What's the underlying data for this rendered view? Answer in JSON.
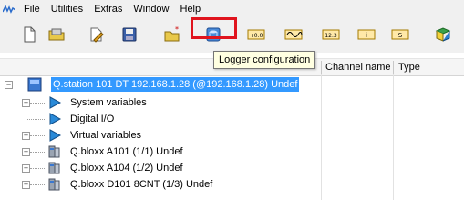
{
  "menubar": {
    "items": [
      "File",
      "Utilities",
      "Extras",
      "Window",
      "Help"
    ]
  },
  "toolbar": {
    "buttons": [
      "new-file-icon",
      "open-folder-icon",
      "edit-file-icon",
      "save-disk-icon",
      "open-special-icon",
      "logger-configuration-icon",
      "numeric-display-icon",
      "signal-icon",
      "numeric-value-icon",
      "indicator-icon",
      "scale-icon",
      "book-icon"
    ],
    "numeric_display_text": "+0.0",
    "numeric_value_text": "12.3",
    "indicator_text": "i",
    "scale_text": "S",
    "highlight_color": "#e0141e"
  },
  "tooltip": {
    "text": "Logger configuration"
  },
  "columns": {
    "channel_name": "Channel name",
    "type": "Type"
  },
  "tree": {
    "root": {
      "label": "Q.station 101 DT 192.168.1.28 (@192.168.1.28) Undef",
      "expander": "−"
    },
    "children": [
      {
        "label": "System variables",
        "expander": "+",
        "icon": "play-triangle-icon"
      },
      {
        "label": "Digital I/O",
        "expander": "",
        "icon": "play-triangle-icon"
      },
      {
        "label": "Virtual variables",
        "expander": "+",
        "icon": "play-triangle-icon"
      },
      {
        "label": "Q.bloxx A101 (1/1) Undef",
        "expander": "+",
        "icon": "module-icon"
      },
      {
        "label": "Q.bloxx A104 (1/2) Undef",
        "expander": "+",
        "icon": "module-icon"
      },
      {
        "label": "Q.bloxx D101 8CNT (1/3) Undef",
        "expander": "+",
        "icon": "module-icon"
      }
    ]
  },
  "colors": {
    "selection": "#3399ff",
    "tooltip_bg": "#ffffe1"
  }
}
